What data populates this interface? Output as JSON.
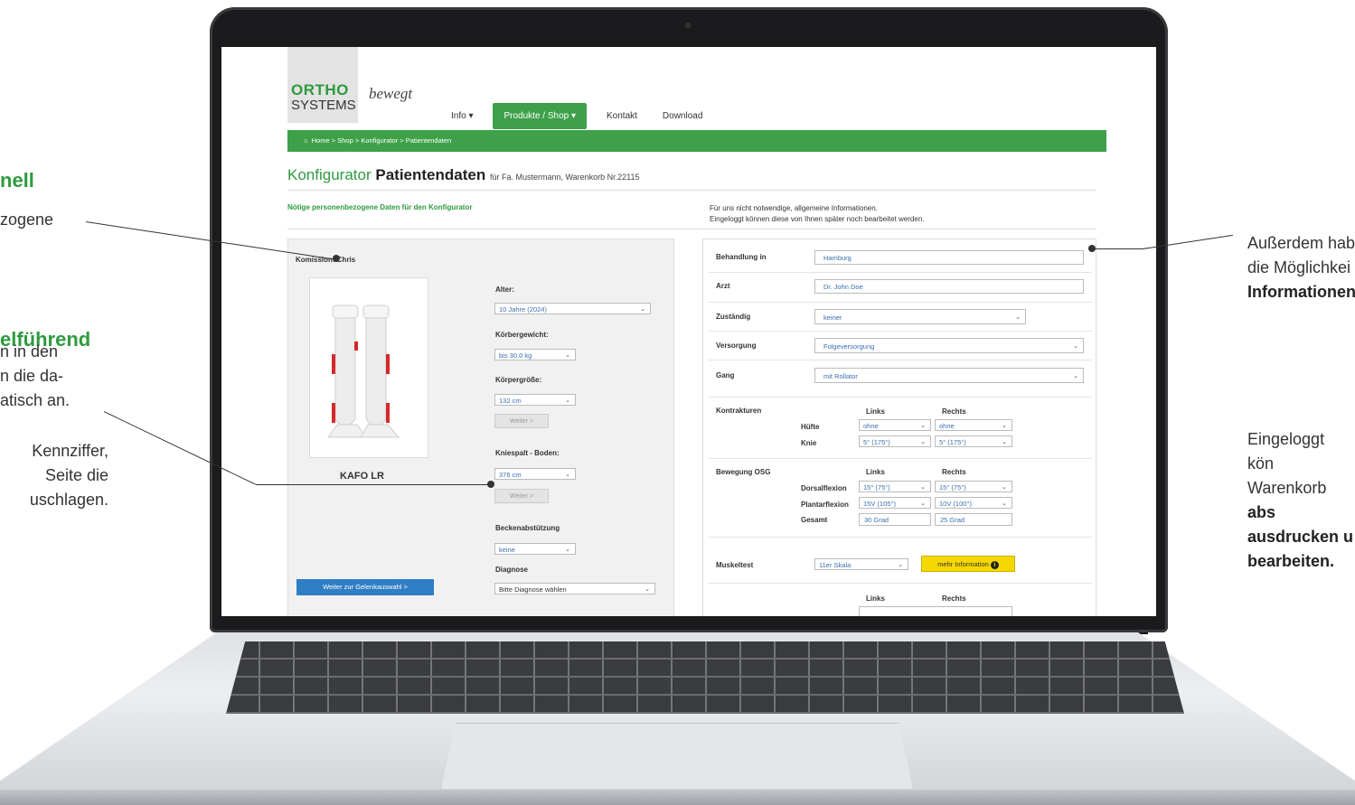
{
  "annotations": {
    "left_1_heading": "nell",
    "left_1_text": "zogene",
    "left_2_heading": "elführend",
    "left_2_lines": [
      "n in den",
      "n die da-",
      "atisch an."
    ],
    "left_3_lines": [
      "Kennziffer,",
      "Seite die",
      "uschlagen."
    ],
    "right_1_lines": [
      "Außerdem hab",
      "die Möglichkei"
    ],
    "right_1_bold": "Informationen",
    "right_2_line1": "Eingeloggt kön",
    "right_2_line2_text": "Warenkorb ",
    "right_2_line2_bold": "abs",
    "right_2_bold_lines": [
      "ausdrucken u",
      "bearbeiten."
    ]
  },
  "header": {
    "logo_top": "ORTHO",
    "logo_bottom": "SYSTEMS",
    "logo_tagline": "bewegt",
    "nav": [
      {
        "label": "Info ▾"
      },
      {
        "label": "Produkte / Shop ▾"
      },
      {
        "label": "Kontakt"
      },
      {
        "label": "Download"
      }
    ]
  },
  "breadcrumb": "Home > Shop > Konfigurator > Patientendaten",
  "title": {
    "main": "Konfigurator",
    "bold": "Patientendaten",
    "suffix": "für Fa. Mustermann, Warenkorb Nr.22115"
  },
  "subheadings": {
    "left": "Nötige personenbezogene Daten für den Konfigurator",
    "right_line1": "Für uns nicht notwendige, allgemeine Informationen.",
    "right_line2": "Eingeloggt können diese von Ihnen später noch bearbeitet werden."
  },
  "left_panel": {
    "commission": "Komission: Chris",
    "product_name": "KAFO LR",
    "alter_label": "Alter:",
    "alter_value": "10 Jahre (2024)",
    "weight_label": "Körbergewicht:",
    "weight_value": "bis 30,0 kg",
    "height_label": "Körpergröße:",
    "height_value": "132 cm",
    "next_label": "Weiter >",
    "knee_label": "Kniespalt - Boden:",
    "knee_value": "376 cm",
    "pelvis_label": "Beckenabstützung",
    "pelvis_value": "keine",
    "diagnosis_label": "Diagnose",
    "diagnosis_value": "Bitte Diagnose wählen",
    "continue_button": "Weiter zur Gelenkauswahl >"
  },
  "right_panel": {
    "treatment_label": "Behandlung in",
    "treatment_value": "Hamburg",
    "doctor_label": "Arzt",
    "doctor_value": "Dr. John Doe",
    "responsible_label": "Zuständig",
    "responsible_value": "keiner",
    "supply_label": "Versorgung",
    "supply_value": "Folgeversorgung",
    "gait_label": "Gang",
    "gait_value": "mit Rollator",
    "contractures_label": "Kontrakturen",
    "links": "Links",
    "rechts": "Rechts",
    "hip_label": "Hüfte",
    "hip_left": "ohne",
    "hip_right": "ohne",
    "knee_label": "Knie",
    "knee_left": "5° (175°)",
    "knee_right": "5° (175°)",
    "movement_label": "Bewegung OSG",
    "dorsal_label": "Dorsalflexion",
    "dorsal_left": "15° (75°)",
    "dorsal_right": "15° (75°)",
    "plantar_label": "Plantarflexion",
    "plantar_left": "15V (105°)",
    "plantar_right": "10V (100°)",
    "total_label": "Gesamt",
    "total_left": "30 Grad",
    "total_right": "25 Grad",
    "muscle_label": "Muskeltest",
    "muscle_value": "11er Skala",
    "more_info": "mehr Information"
  }
}
